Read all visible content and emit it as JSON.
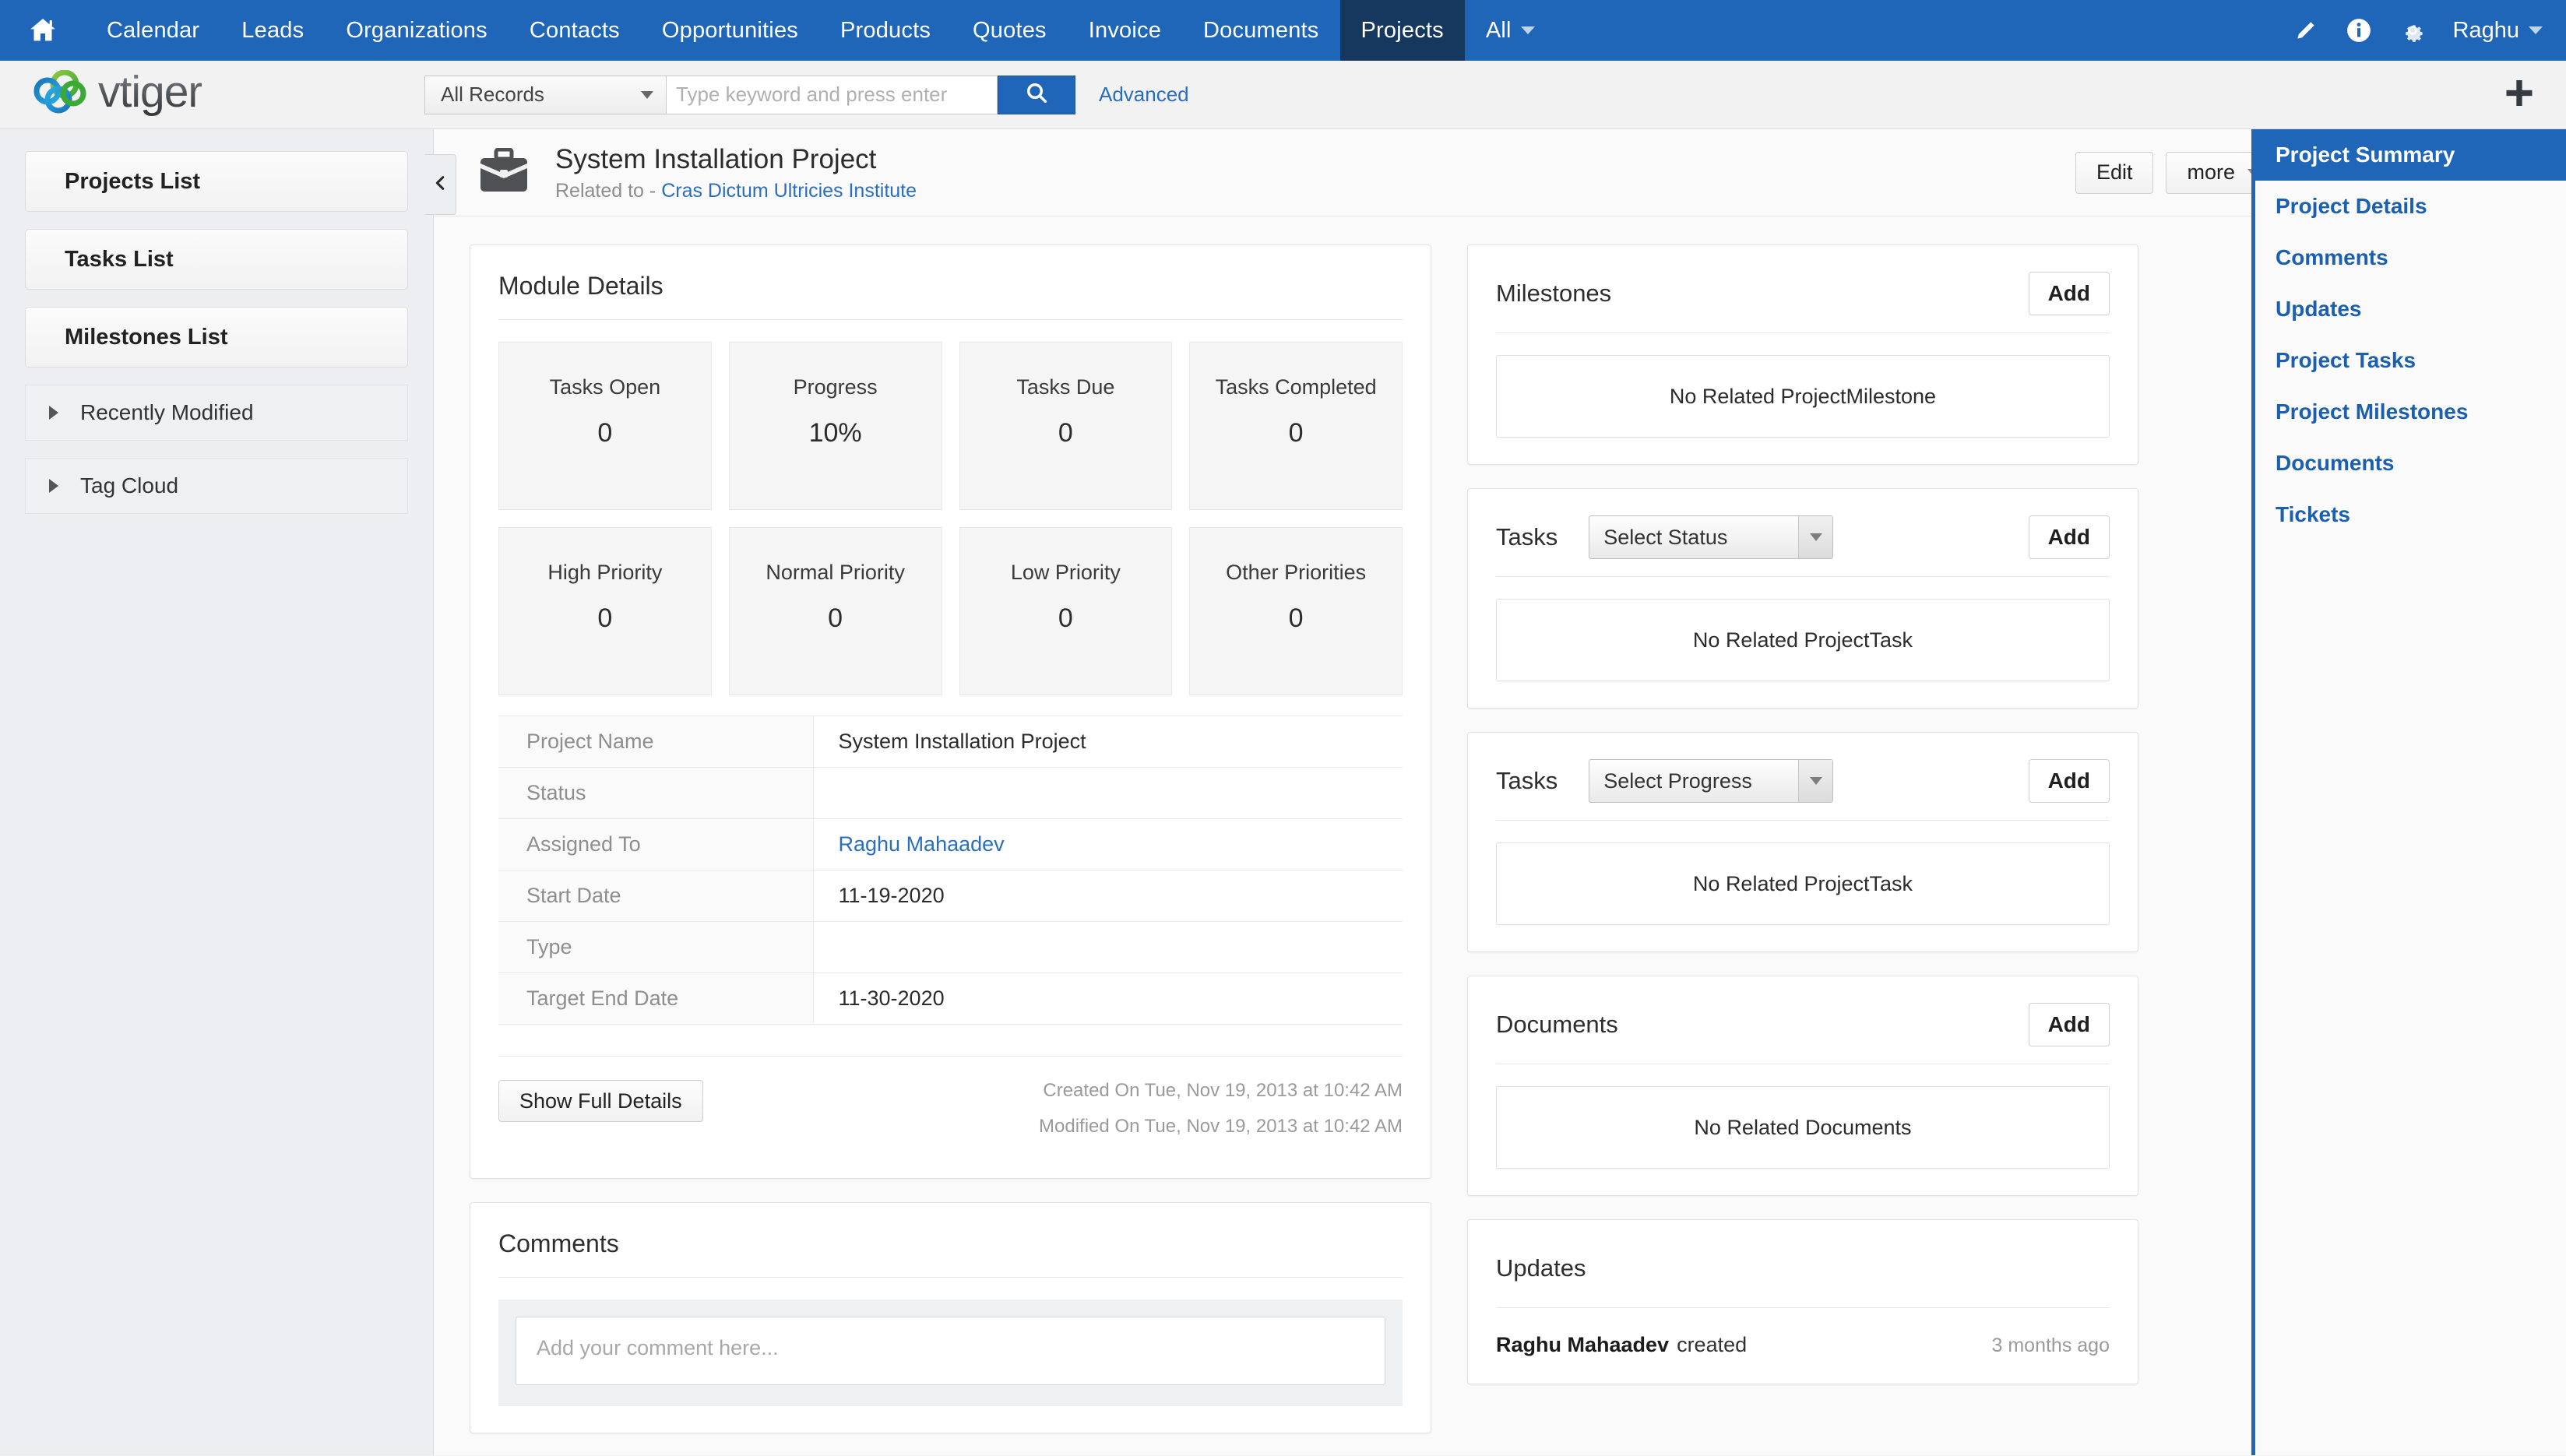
{
  "topnav": {
    "home_icon": "home-icon",
    "items": [
      {
        "label": "Calendar",
        "active": false
      },
      {
        "label": "Leads",
        "active": false
      },
      {
        "label": "Organizations",
        "active": false
      },
      {
        "label": "Contacts",
        "active": false
      },
      {
        "label": "Opportunities",
        "active": false
      },
      {
        "label": "Products",
        "active": false
      },
      {
        "label": "Quotes",
        "active": false
      },
      {
        "label": "Invoice",
        "active": false
      },
      {
        "label": "Documents",
        "active": false
      },
      {
        "label": "Projects",
        "active": true
      }
    ],
    "all_label": "All",
    "user_label": "Raghu",
    "icons": [
      "pencil-icon",
      "info-icon",
      "gear-icon"
    ],
    "accent_color": "#1f65b8",
    "active_tab_color": "#16375e"
  },
  "search": {
    "logo_text": "vtiger",
    "records_filter": "All Records",
    "placeholder": "Type keyword and press enter",
    "value": "",
    "advanced_label": "Advanced",
    "search_icon": "search-icon",
    "add_icon": "plus-icon"
  },
  "sidebar": {
    "buttons": [
      {
        "label": "Projects List"
      },
      {
        "label": "Tasks List"
      },
      {
        "label": "Milestones List"
      }
    ],
    "accordions": [
      {
        "label": "Recently Modified"
      },
      {
        "label": "Tag Cloud"
      }
    ]
  },
  "record": {
    "icon": "briefcase-icon",
    "title": "System Installation Project",
    "related_prefix": "Related to - ",
    "related_to": "Cras Dictum Ultricies Institute",
    "actions": {
      "edit": "Edit",
      "more": "more",
      "tools_icon": "wrench-icon"
    },
    "pager": {
      "prev": "prev-icon",
      "next": "next-icon"
    }
  },
  "module_details": {
    "title": "Module Details",
    "tiles": [
      {
        "label": "Tasks Open",
        "value": "0"
      },
      {
        "label": "Progress",
        "value": "10%"
      },
      {
        "label": "Tasks Due",
        "value": "0"
      },
      {
        "label": "Tasks Completed",
        "value": "0"
      },
      {
        "label": "High Priority",
        "value": "0"
      },
      {
        "label": "Normal Priority",
        "value": "0"
      },
      {
        "label": "Low Priority",
        "value": "0"
      },
      {
        "label": "Other Priorities",
        "value": "0"
      }
    ],
    "fields": [
      {
        "label": "Project Name",
        "value": "System Installation Project",
        "link": false
      },
      {
        "label": "Status",
        "value": "",
        "link": false
      },
      {
        "label": "Assigned To",
        "value": "Raghu Mahaadev",
        "link": true
      },
      {
        "label": "Start Date",
        "value": "11-19-2020",
        "link": false
      },
      {
        "label": "Type",
        "value": "",
        "link": false
      },
      {
        "label": "Target End Date",
        "value": "11-30-2020",
        "link": false
      }
    ],
    "show_full_details": "Show Full Details",
    "created_on": "Created On Tue, Nov 19, 2013 at 10:42 AM",
    "modified_on": "Modified On Tue, Nov 19, 2013 at 10:42 AM"
  },
  "comments": {
    "title": "Comments",
    "placeholder": "Add your comment here...",
    "value": ""
  },
  "panels": {
    "milestones": {
      "title": "Milestones",
      "add_label": "Add",
      "empty_text": "No Related ProjectMilestone"
    },
    "tasks_status": {
      "title": "Tasks",
      "select_value": "Select Status",
      "add_label": "Add",
      "empty_text": "No Related ProjectTask"
    },
    "tasks_progress": {
      "title": "Tasks",
      "select_value": "Select Progress",
      "add_label": "Add",
      "empty_text": "No Related ProjectTask"
    },
    "documents": {
      "title": "Documents",
      "add_label": "Add",
      "empty_text": "No Related Documents"
    },
    "updates": {
      "title": "Updates",
      "entries": [
        {
          "actor": "Raghu Mahaadev",
          "action": "created",
          "time": "3 months ago"
        }
      ]
    }
  },
  "rightnav": {
    "items": [
      {
        "label": "Project Summary",
        "active": true
      },
      {
        "label": "Project Details",
        "active": false
      },
      {
        "label": "Comments",
        "active": false
      },
      {
        "label": "Updates",
        "active": false
      },
      {
        "label": "Project Tasks",
        "active": false
      },
      {
        "label": "Project Milestones",
        "active": false
      },
      {
        "label": "Documents",
        "active": false
      },
      {
        "label": "Tickets",
        "active": false
      }
    ]
  }
}
